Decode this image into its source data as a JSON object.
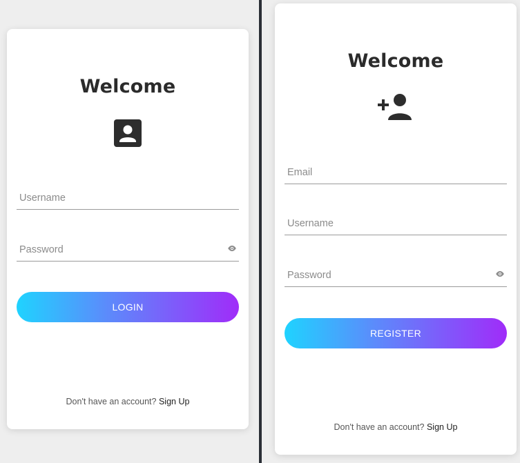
{
  "login": {
    "title": "Welcome",
    "icon": "account-box-icon",
    "username_placeholder": "Username",
    "password_placeholder": "Password",
    "button_label": "LOGIN",
    "footer_text": "Don't have an account?",
    "footer_link": "Sign Up"
  },
  "register": {
    "title": "Welcome",
    "icon": "person-add-icon",
    "email_placeholder": "Email",
    "username_placeholder": "Username",
    "password_placeholder": "Password",
    "button_label": "REGISTER",
    "footer_text": "Don't have an account?",
    "footer_link": "Sign Up"
  },
  "colors": {
    "background": "#eeeeee",
    "card": "#ffffff",
    "divider": "#2b2f36",
    "gradient_start": "#1fd3ff",
    "gradient_end": "#a02cf9",
    "heading": "#2b2b2b"
  }
}
